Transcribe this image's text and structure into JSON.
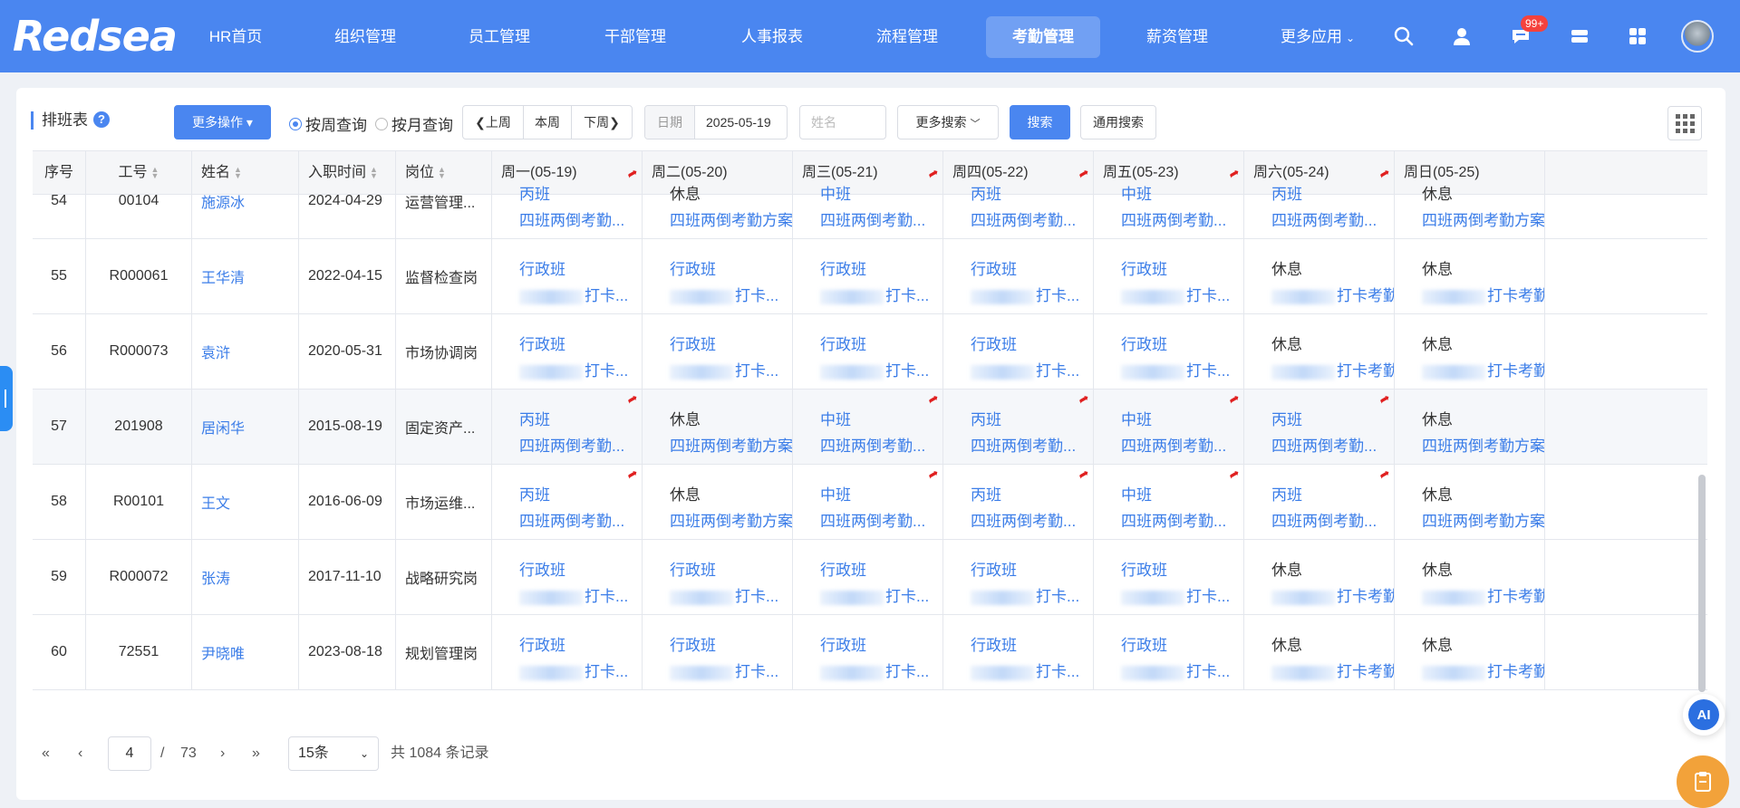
{
  "topbar": {
    "logo": "Redsea",
    "nav": [
      "HR首页",
      "组织管理",
      "员工管理",
      "干部管理",
      "人事报表",
      "流程管理",
      "考勤管理",
      "薪资管理",
      "更多应用"
    ],
    "active_nav": "考勤管理",
    "badge": "99+"
  },
  "toolbar": {
    "title": "排班表",
    "more_ops": "更多操作",
    "radio_week": "按周查询",
    "radio_month": "按月查询",
    "prev_week": "上周",
    "this_week": "本周",
    "next_week": "下周",
    "date_label": "日期",
    "date_value": "2025-05-19",
    "name_placeholder": "姓名",
    "more_search": "更多搜索",
    "search": "搜索",
    "general_search": "通用搜索"
  },
  "table": {
    "headers": [
      "序号",
      "工号",
      "姓名",
      "入职时间",
      "岗位",
      "周一(05-19)",
      "周二(05-20)",
      "周三(05-21)",
      "周四(05-22)",
      "周五(05-23)",
      "周六(05-24)",
      "周日(05-25)"
    ],
    "rows": [
      {
        "no": "54",
        "id": "00104",
        "name": "施源冰",
        "date": "2024-04-29",
        "post": "运营管理...",
        "hl": false,
        "days": [
          [
            "丙班",
            "四班两倒考勤...",
            true
          ],
          [
            "休息",
            "四班两倒考勤方案",
            false
          ],
          [
            "中班",
            "四班两倒考勤...",
            true
          ],
          [
            "丙班",
            "四班两倒考勤...",
            true
          ],
          [
            "中班",
            "四班两倒考勤...",
            true
          ],
          [
            "丙班",
            "四班两倒考勤...",
            true
          ],
          [
            "休息",
            "四班两倒考勤方案",
            false
          ]
        ]
      },
      {
        "no": "55",
        "id": "R000061",
        "name": "王华清",
        "date": "2022-04-15",
        "post": "监督检查岗",
        "hl": false,
        "days": [
          [
            "行政班",
            "打卡...",
            false
          ],
          [
            "行政班",
            "打卡...",
            false
          ],
          [
            "行政班",
            "打卡...",
            false
          ],
          [
            "行政班",
            "打卡...",
            false
          ],
          [
            "行政班",
            "打卡...",
            false
          ],
          [
            "休息",
            "打卡考勤",
            false
          ],
          [
            "休息",
            "打卡考勤",
            false
          ]
        ]
      },
      {
        "no": "56",
        "id": "R000073",
        "name": "袁浒",
        "date": "2020-05-31",
        "post": "市场协调岗",
        "hl": false,
        "days": [
          [
            "行政班",
            "打卡...",
            false
          ],
          [
            "行政班",
            "打卡...",
            false
          ],
          [
            "行政班",
            "打卡...",
            false
          ],
          [
            "行政班",
            "打卡...",
            false
          ],
          [
            "行政班",
            "打卡...",
            false
          ],
          [
            "休息",
            "打卡考勤",
            false
          ],
          [
            "休息",
            "打卡考勤",
            false
          ]
        ]
      },
      {
        "no": "57",
        "id": "201908",
        "name": "居闲华",
        "date": "2015-08-19",
        "post": "固定资产...",
        "hl": true,
        "days": [
          [
            "丙班",
            "四班两倒考勤...",
            true
          ],
          [
            "休息",
            "四班两倒考勤方案",
            false
          ],
          [
            "中班",
            "四班两倒考勤...",
            true
          ],
          [
            "丙班",
            "四班两倒考勤...",
            true
          ],
          [
            "中班",
            "四班两倒考勤...",
            true
          ],
          [
            "丙班",
            "四班两倒考勤...",
            true
          ],
          [
            "休息",
            "四班两倒考勤方案",
            false
          ]
        ]
      },
      {
        "no": "58",
        "id": "R00101",
        "name": "王文",
        "date": "2016-06-09",
        "post": "市场运维...",
        "hl": false,
        "days": [
          [
            "丙班",
            "四班两倒考勤...",
            true
          ],
          [
            "休息",
            "四班两倒考勤方案",
            false
          ],
          [
            "中班",
            "四班两倒考勤...",
            true
          ],
          [
            "丙班",
            "四班两倒考勤...",
            true
          ],
          [
            "中班",
            "四班两倒考勤...",
            true
          ],
          [
            "丙班",
            "四班两倒考勤...",
            true
          ],
          [
            "休息",
            "四班两倒考勤方案",
            false
          ]
        ]
      },
      {
        "no": "59",
        "id": "R000072",
        "name": "张涛",
        "date": "2017-11-10",
        "post": "战略研究岗",
        "hl": false,
        "days": [
          [
            "行政班",
            "打卡...",
            false
          ],
          [
            "行政班",
            "打卡...",
            false
          ],
          [
            "行政班",
            "打卡...",
            false
          ],
          [
            "行政班",
            "打卡...",
            false
          ],
          [
            "行政班",
            "打卡...",
            false
          ],
          [
            "休息",
            "打卡考勤",
            false
          ],
          [
            "休息",
            "打卡考勤",
            false
          ]
        ]
      },
      {
        "no": "60",
        "id": "72551",
        "name": "尹晓唯",
        "date": "2023-08-18",
        "post": "规划管理岗",
        "hl": false,
        "days": [
          [
            "行政班",
            "打卡...",
            false
          ],
          [
            "行政班",
            "打卡...",
            false
          ],
          [
            "行政班",
            "打卡...",
            false
          ],
          [
            "行政班",
            "打卡...",
            false
          ],
          [
            "行政班",
            "打卡...",
            false
          ],
          [
            "休息",
            "打卡考勤",
            false
          ],
          [
            "休息",
            "打卡考勤",
            false
          ]
        ]
      }
    ]
  },
  "pagination": {
    "current": "4",
    "sep": "/",
    "total_pages": "73",
    "page_size": "15条",
    "total_prefix": "共",
    "total": "1084",
    "total_suffix": "条记录"
  },
  "ai_label": "AI"
}
